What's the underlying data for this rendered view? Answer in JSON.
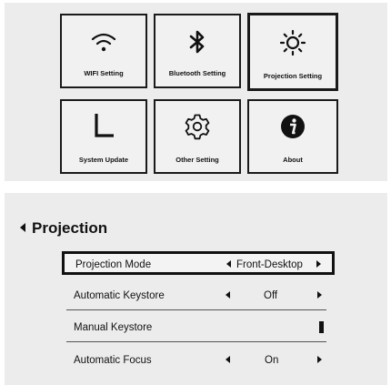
{
  "menu": {
    "tiles": [
      {
        "label": "WIFI Setting",
        "icon": "wifi-icon"
      },
      {
        "label": "Bluetooth Setting",
        "icon": "bluetooth-icon"
      },
      {
        "label": "Projection  Setting",
        "icon": "sun-icon",
        "selected": true
      },
      {
        "label": "System Update",
        "icon": "system-update-icon"
      },
      {
        "label": "Other Setting",
        "icon": "gear-icon"
      },
      {
        "label": "About",
        "icon": "info-icon"
      }
    ]
  },
  "projection": {
    "title": "Projection",
    "rows": [
      {
        "label": "Projection Mode",
        "value": "Front-Desktop",
        "selected": true
      },
      {
        "label": "Automatic Keystore",
        "value": "Off"
      },
      {
        "label": "Manual Keystore",
        "value": ""
      },
      {
        "label": "Automatic Focus",
        "value": "On"
      }
    ]
  }
}
